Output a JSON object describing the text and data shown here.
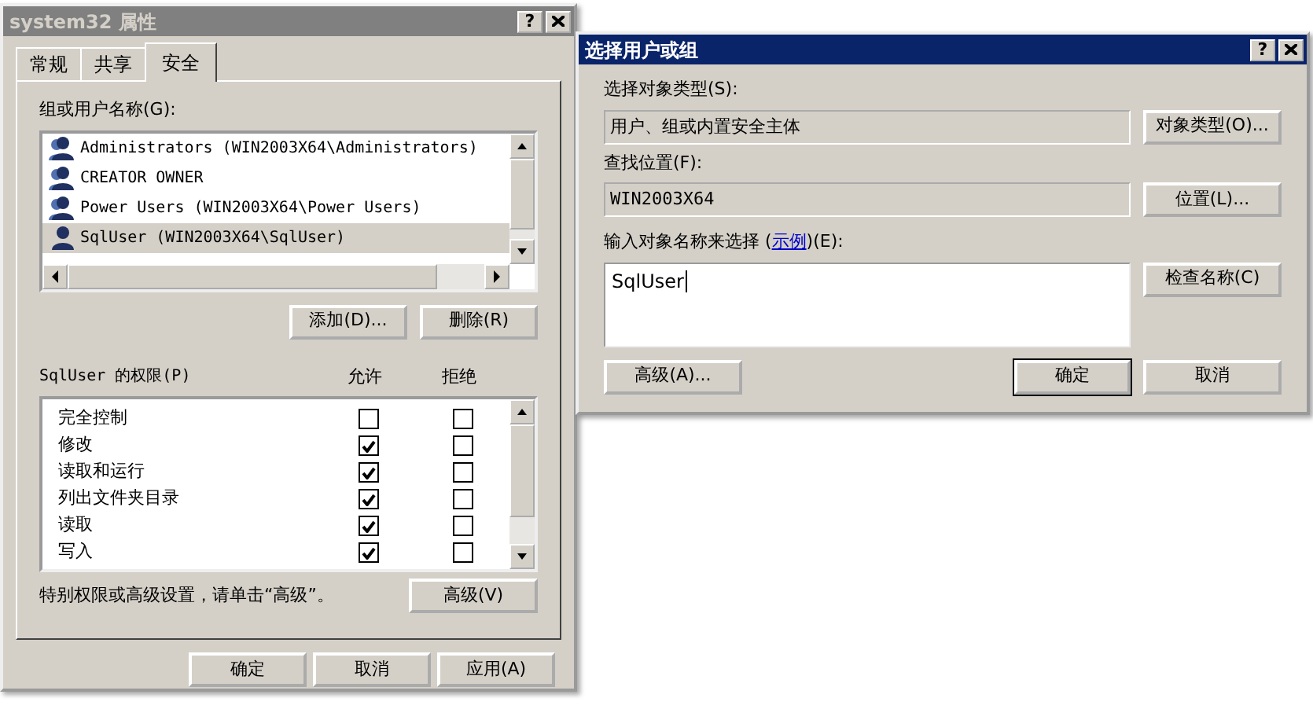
{
  "properties_window": {
    "title": "system32 属性",
    "help_button": "?",
    "tabs": [
      {
        "label": "常规",
        "selected": false
      },
      {
        "label": "共享",
        "selected": false
      },
      {
        "label": "安全",
        "selected": true
      }
    ],
    "groups_label": "组或用户名称(G):",
    "users": [
      {
        "name": "Administrators (WIN2003X64\\Administrators)",
        "kind": "group",
        "selected": false
      },
      {
        "name": "CREATOR OWNER",
        "kind": "group",
        "selected": false
      },
      {
        "name": "Power Users (WIN2003X64\\Power Users)",
        "kind": "group",
        "selected": false
      },
      {
        "name": "SqlUser (WIN2003X64\\SqlUser)",
        "kind": "user",
        "selected": true
      }
    ],
    "add_button": "添加(D)...",
    "remove_button": "删除(R)",
    "permissions_label": "SqlUser 的权限(P)",
    "allow_header": "允许",
    "deny_header": "拒绝",
    "permissions": [
      {
        "name": "完全控制",
        "allow": false,
        "deny": false
      },
      {
        "name": "修改",
        "allow": true,
        "deny": false
      },
      {
        "name": "读取和运行",
        "allow": true,
        "deny": false
      },
      {
        "name": "列出文件夹目录",
        "allow": true,
        "deny": false
      },
      {
        "name": "读取",
        "allow": true,
        "deny": false
      },
      {
        "name": "写入",
        "allow": true,
        "deny": false
      }
    ],
    "advanced_hint": "特别权限或高级设置，请单击“高级”。",
    "advanced_button": "高级(V)",
    "buttons": [
      "确定",
      "取消",
      "应用(A)"
    ]
  },
  "select_dialog": {
    "title": "选择用户或组",
    "help_button": "?",
    "object_type_label": "选择对象类型(S):",
    "object_type_value": "用户、组或内置安全主体",
    "object_type_button": "对象类型(O)...",
    "location_label": "查找位置(F):",
    "location_value": "WIN2003X64",
    "location_button": "位置(L)...",
    "names_label_before": "输入对象名称来选择 (",
    "names_label_link": "示例",
    "names_label_after": ")(E):",
    "names_value": "SqlUser",
    "check_names_button": "检查名称(C)",
    "advanced_button": "高级(A)...",
    "ok_button": "确定",
    "cancel_button": "取消"
  }
}
